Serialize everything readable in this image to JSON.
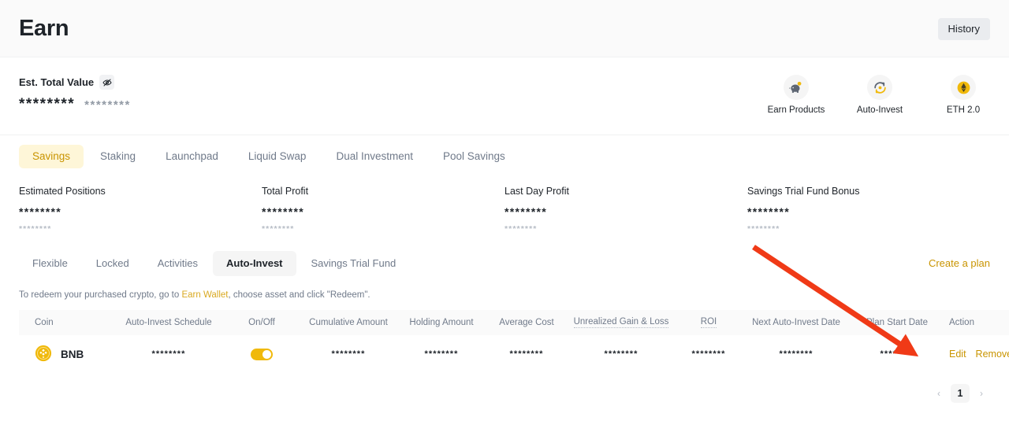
{
  "header": {
    "title": "Earn",
    "history_label": "History"
  },
  "summary": {
    "est_total_label": "Est. Total Value",
    "eye_icon": "eye-off-icon",
    "est_primary_value": "********",
    "est_secondary_value": "********",
    "quicklinks": [
      {
        "label": "Earn Products",
        "icon": "piggy-bank-icon"
      },
      {
        "label": "Auto-Invest",
        "icon": "auto-invest-refresh-icon"
      },
      {
        "label": "ETH 2.0",
        "icon": "ethereum-icon"
      }
    ]
  },
  "main_tabs": [
    {
      "label": "Savings",
      "active": true
    },
    {
      "label": "Staking",
      "active": false
    },
    {
      "label": "Launchpad",
      "active": false
    },
    {
      "label": "Liquid Swap",
      "active": false
    },
    {
      "label": "Dual Investment",
      "active": false
    },
    {
      "label": "Pool Savings",
      "active": false
    }
  ],
  "stats": [
    {
      "label": "Estimated Positions",
      "primary": "********",
      "secondary": "********"
    },
    {
      "label": "Total Profit",
      "primary": "********",
      "secondary": "********"
    },
    {
      "label": "Last Day Profit",
      "primary": "********",
      "secondary": "********"
    },
    {
      "label": "Savings Trial Fund Bonus",
      "primary": "********",
      "secondary": "********"
    }
  ],
  "sub_tabs": [
    {
      "label": "Flexible",
      "active": false
    },
    {
      "label": "Locked",
      "active": false
    },
    {
      "label": "Activities",
      "active": false
    },
    {
      "label": "Auto-Invest",
      "active": true
    },
    {
      "label": "Savings Trial Fund",
      "active": false
    }
  ],
  "create_plan_label": "Create a plan",
  "note": {
    "before": "To redeem your purchased crypto, go to ",
    "link": "Earn Wallet",
    "after": ", choose asset and click \"Redeem\"."
  },
  "table": {
    "columns": [
      {
        "label": "Coin",
        "dotted": false
      },
      {
        "label": "Auto-Invest Schedule",
        "dotted": false
      },
      {
        "label": "On/Off",
        "dotted": false
      },
      {
        "label": "Cumulative Amount",
        "dotted": false
      },
      {
        "label": "Holding Amount",
        "dotted": false
      },
      {
        "label": "Average Cost",
        "dotted": false
      },
      {
        "label": "Unrealized Gain & Loss",
        "dotted": true
      },
      {
        "label": "ROI",
        "dotted": true
      },
      {
        "label": "Next Auto-Invest Date",
        "dotted": false
      },
      {
        "label": "Plan Start Date",
        "dotted": false
      },
      {
        "label": "Action",
        "dotted": false
      }
    ],
    "rows": [
      {
        "coin_icon": "bnb-coin-icon",
        "coin": "BNB",
        "schedule": "********",
        "on_off": true,
        "cumulative_amount": "********",
        "holding_amount": "********",
        "average_cost": "********",
        "unrealized_gain_loss": "********",
        "roi": "********",
        "next_auto_invest_date": "********",
        "plan_start_date": "********",
        "edit_label": "Edit",
        "remove_label": "Remove Plan"
      }
    ]
  },
  "pagination": {
    "prev": "‹",
    "page": "1",
    "next": "›"
  },
  "colors": {
    "accent": "#f0b90b",
    "accent_text": "#c99400",
    "active_tab_bg": "#fef6d8",
    "muted_text": "#707a8a",
    "annotation": "#f03a17"
  }
}
